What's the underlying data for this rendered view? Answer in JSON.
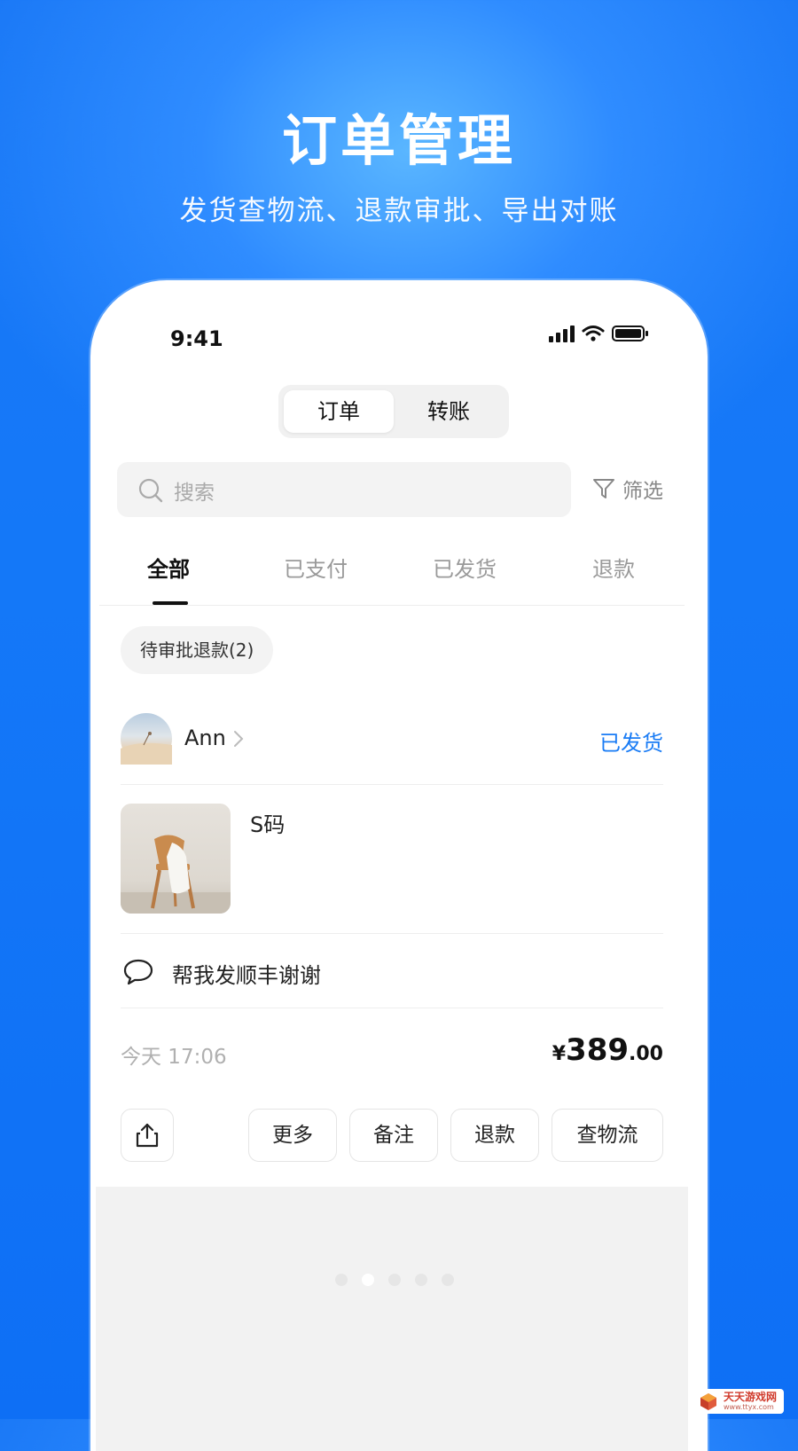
{
  "hero": {
    "title": "订单管理",
    "subtitle": "发货查物流、退款审批、导出对账"
  },
  "status_bar": {
    "time": "9:41"
  },
  "segment": {
    "tabs": [
      "订单",
      "转账"
    ],
    "active_index": 0
  },
  "search": {
    "placeholder": "搜索",
    "filter_label": "筛选"
  },
  "tabs": {
    "items": [
      "全部",
      "已支付",
      "已发货",
      "退款"
    ],
    "active_index": 0
  },
  "chip": {
    "label": "待审批退款(2)"
  },
  "order": {
    "user_name": "Ann",
    "status": "已发货",
    "status_color": "#1a7cf5",
    "spec": "S码",
    "note": "帮我发顺丰谢谢",
    "time": "今天 17:06",
    "price_symbol": "¥",
    "price_int": "389",
    "price_dec": ".00",
    "actions": [
      "更多",
      "备注",
      "退款",
      "查物流"
    ]
  },
  "carousel": {
    "dot_count": 5,
    "active_index": 1
  },
  "watermark": {
    "text": "天天游戏网",
    "url": "www.ttyx.com"
  },
  "colors": {
    "brand_blue": "#1478f8",
    "accent_blue": "#1a7cf5"
  }
}
